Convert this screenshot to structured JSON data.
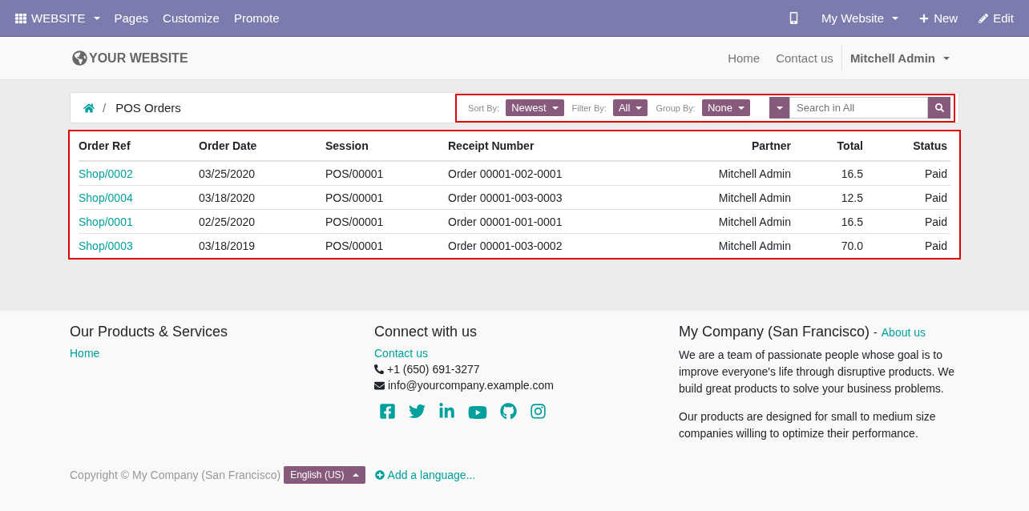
{
  "admin_bar": {
    "app_menu": "WEBSITE",
    "menu": [
      "Pages",
      "Customize",
      "Promote"
    ],
    "website_switcher": "My Website",
    "new_button": "New",
    "edit_button": "Edit"
  },
  "header": {
    "logo": "YOUR WEBSITE",
    "nav": [
      "Home",
      "Contact us"
    ],
    "user": "Mitchell Admin"
  },
  "breadcrumb": {
    "separator": "/",
    "current": "POS Orders"
  },
  "toolbar": {
    "controls": [
      {
        "label": "Sort By:",
        "value": "Newest"
      },
      {
        "label": "Filter By:",
        "value": "All"
      },
      {
        "label": "Group By:",
        "value": "None"
      }
    ],
    "search": {
      "placeholder": "Search in All"
    }
  },
  "table": {
    "columns": [
      "Order Ref",
      "Order Date",
      "Session",
      "Receipt Number",
      "Partner",
      "Total",
      "Status"
    ],
    "rows": [
      [
        "Shop/0002",
        "03/25/2020",
        "POS/00001",
        "Order 00001-002-0001",
        "Mitchell Admin",
        "16.5",
        "Paid"
      ],
      [
        "Shop/0004",
        "03/18/2020",
        "POS/00001",
        "Order 00001-003-0003",
        "Mitchell Admin",
        "12.5",
        "Paid"
      ],
      [
        "Shop/0001",
        "02/25/2020",
        "POS/00001",
        "Order 00001-001-0001",
        "Mitchell Admin",
        "16.5",
        "Paid"
      ],
      [
        "Shop/0003",
        "03/18/2019",
        "POS/00001",
        "Order 00001-003-0002",
        "Mitchell Admin",
        "70.0",
        "Paid"
      ]
    ]
  },
  "footer": {
    "products": {
      "title": "Our Products & Services",
      "links": [
        "Home"
      ]
    },
    "connect": {
      "title": "Connect with us",
      "link": "Contact us",
      "phone": "+1 (650) 691-3277",
      "email": "info@yourcompany.example.com"
    },
    "company": {
      "title": "My Company (San Francisco)",
      "separator": "-",
      "link": "About us",
      "paragraphs": [
        "We are a team of passionate people whose goal is to improve everyone's life through disruptive products. We build great products to solve your business problems.",
        "Our products are designed for small to medium size companies willing to optimize their performance."
      ]
    },
    "copyright": "Copyright © My Company (San Francisco)",
    "language": "English (US)",
    "add_language": "Add a language..."
  }
}
